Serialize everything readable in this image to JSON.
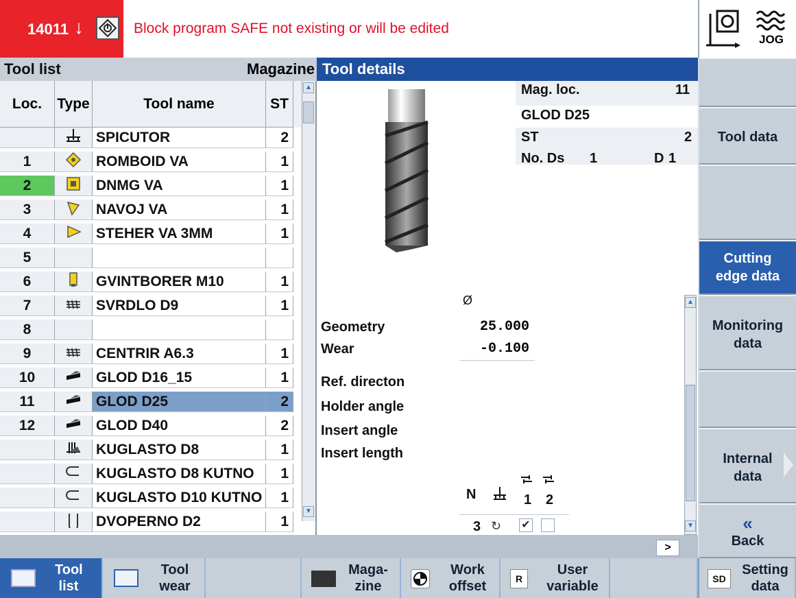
{
  "alarm": {
    "number": "14011",
    "arrow": "↓",
    "message": "Block  program SAFE not existing or will be edited"
  },
  "mode": {
    "jog_label": "JOG"
  },
  "tool_list": {
    "title": "Tool list",
    "magazine_label": "Magazine",
    "columns": [
      "Loc.",
      "Type",
      "Tool name",
      "ST"
    ],
    "rows": [
      {
        "loc": "",
        "type": "spindle",
        "name": "SPICUTOR",
        "st": "2"
      },
      {
        "loc": "1",
        "type": "rhombus-insert",
        "name": "ROMBOID VA",
        "st": "1"
      },
      {
        "loc": "2",
        "type": "dnmg-insert",
        "name": "DNMG VA",
        "st": "1"
      },
      {
        "loc": "3",
        "type": "thread-insert",
        "name": "NAVOJ VA",
        "st": "1"
      },
      {
        "loc": "4",
        "type": "groove-tool",
        "name": "STEHER VA 3MM",
        "st": "1"
      },
      {
        "loc": "5",
        "type": "",
        "name": "",
        "st": ""
      },
      {
        "loc": "6",
        "type": "tap",
        "name": "GVINTBORER M10",
        "st": "1"
      },
      {
        "loc": "7",
        "type": "drill",
        "name": "SVRDLO D9",
        "st": "1"
      },
      {
        "loc": "8",
        "type": "",
        "name": "",
        "st": ""
      },
      {
        "loc": "9",
        "type": "drill",
        "name": "CENTRIR A6.3",
        "st": "1"
      },
      {
        "loc": "10",
        "type": "mill",
        "name": "GLOD D16_15",
        "st": "1"
      },
      {
        "loc": "11",
        "type": "mill",
        "name": "GLOD D25",
        "st": "2"
      },
      {
        "loc": "12",
        "type": "mill",
        "name": "GLOD D40",
        "st": "2"
      },
      {
        "loc": "",
        "type": "ball-mill",
        "name": "KUGLASTO D8",
        "st": "1"
      },
      {
        "loc": "",
        "type": "ball-mill-u",
        "name": "KUGLASTO D8 KUTNO",
        "st": "1"
      },
      {
        "loc": "",
        "type": "ball-mill-u",
        "name": "KUGLASTO D10 KUTNO",
        "st": "1"
      },
      {
        "loc": "",
        "type": "double-drill",
        "name": "DVOPERNO D2",
        "st": "1"
      }
    ]
  },
  "details": {
    "title": "Tool details",
    "mag_loc_label": "Mag. loc.",
    "mag_loc_value": "11",
    "tool_name": "GLOD D25",
    "st_label": "ST",
    "st_value": "2",
    "nods_label": "No. Ds",
    "nods_value": "1",
    "d_label": "D",
    "d_value": "1",
    "diameter_symbol": "Ø",
    "geometry_label": "Geometry",
    "geometry_value": "25.000",
    "wear_label": "Wear",
    "wear_value": "-0.100",
    "ref_direction_label": "Ref. directon",
    "holder_angle_label": "Holder angle",
    "insert_angle_label": "Insert angle",
    "insert_length_label": "Insert length",
    "n_label": "N",
    "n_value": "3",
    "coolant1_label": "1",
    "coolant2_label": "2",
    "coolant1_checked": true,
    "coolant2_checked": false,
    "hscroll_label": ">"
  },
  "softkeys_right": {
    "tool_data": "Tool data",
    "cutting_1": "Cutting",
    "cutting_2": "edge data",
    "monitoring_1": "Monitoring",
    "monitoring_2": "data",
    "internal_1": "Internal",
    "internal_2": "data",
    "back_arrow": "«",
    "back": "Back"
  },
  "softkeys_bottom": {
    "toollist_1": "Tool",
    "toollist_2": "list",
    "toolwear_1": "Tool",
    "toolwear_2": "wear",
    "magazine_1": "Maga-",
    "magazine_2": "zine",
    "workoffset_1": "Work",
    "workoffset_2": "offset",
    "user_1": "User",
    "user_2": "variable",
    "user_badge": "R",
    "setting_1": "Setting",
    "setting_2": "data",
    "setting_badge": "SD"
  }
}
